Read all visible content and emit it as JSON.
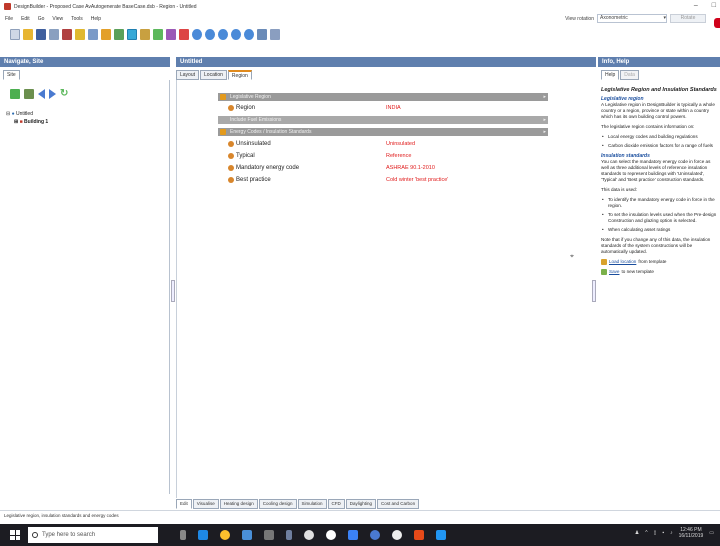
{
  "window": {
    "title": "DesignBuilder - Proposed Case AvAutogenerate BaseCase.dsb - Region - Untitled",
    "controls": [
      "–",
      "□"
    ]
  },
  "menu": [
    "File",
    "Edit",
    "Go",
    "View",
    "Tools",
    "Help"
  ],
  "view_rotation": {
    "label": "View rotation",
    "value": "Axonometric",
    "button": "Rotate"
  },
  "left_panel": {
    "header": "Navigate, Site",
    "tab": "Site",
    "tree": {
      "root": "Untitled",
      "child": "Building 1"
    }
  },
  "center_panel": {
    "header": "Untitled",
    "tabs": [
      "Layout",
      "Location",
      "Region"
    ],
    "active_tab": "Region",
    "sections": [
      {
        "title": "Legislative Region"
      },
      {
        "title": "Include Fuel Emissions"
      },
      {
        "title": "Energy Codes / Insulation Standards"
      }
    ],
    "region_row": {
      "label": "Region",
      "value": "INDIA"
    },
    "rows": [
      {
        "label": "Unsinsulated",
        "value": "Uninsulated"
      },
      {
        "label": "Typical",
        "value": "Reference"
      },
      {
        "label": "Mandatory energy code",
        "value": "ASHRAE 90.1-2010"
      },
      {
        "label": "Best practice",
        "value": "Cold winter 'best practice'"
      }
    ],
    "bottom_tabs": [
      "Edit",
      "Visualise",
      "Heating design",
      "Cooling design",
      "Simulation",
      "CFD",
      "Daylighting",
      "Cost and Carbon"
    ]
  },
  "right_panel": {
    "header": "Info, Help",
    "tabs": [
      "Help",
      "Data"
    ],
    "title": "Legislative Region and Insulation Standards",
    "h_region": "Legislative region",
    "p1": "A Legislative region in DesignBuilder is typically a whole country or a region, province or state within a country which has its own building control powers.",
    "p2": "The legislative region contains information on:",
    "list1": [
      "Local energy codes and building regulations",
      "Carbon dioxide emission factors for a range of fuels"
    ],
    "h_insulation": "Insulation standards",
    "p3": "You can select the mandatory energy code in force as well as three additional levels of reference insulation standards to represent buildings with 'Uninsulated', 'Typical' and 'Best practice' construction standards.",
    "p4": "This data is used:",
    "list2": [
      "To identify the mandatory energy code in force in the region.",
      "To set the insulation levels used when the Pre-design Construction and glazing option is selected.",
      "When calculating asset ratings"
    ],
    "p5": "Note that if you change any of this data, the insulation standards of the system constructions will be automatically updated.",
    "link1": "Load location",
    "link1_rest": "from template",
    "link2": "Save",
    "link2_rest": "to new template"
  },
  "status_bar": "Legislative region, insulation standards and energy codes",
  "taskbar": {
    "search_placeholder": "Type here to search",
    "time": "12:46 PM",
    "date": "16/11/2019"
  },
  "colors": {
    "panel_header": "#5f7fae",
    "value_red": "#e01b1b",
    "link_blue": "#1a4e9e"
  }
}
